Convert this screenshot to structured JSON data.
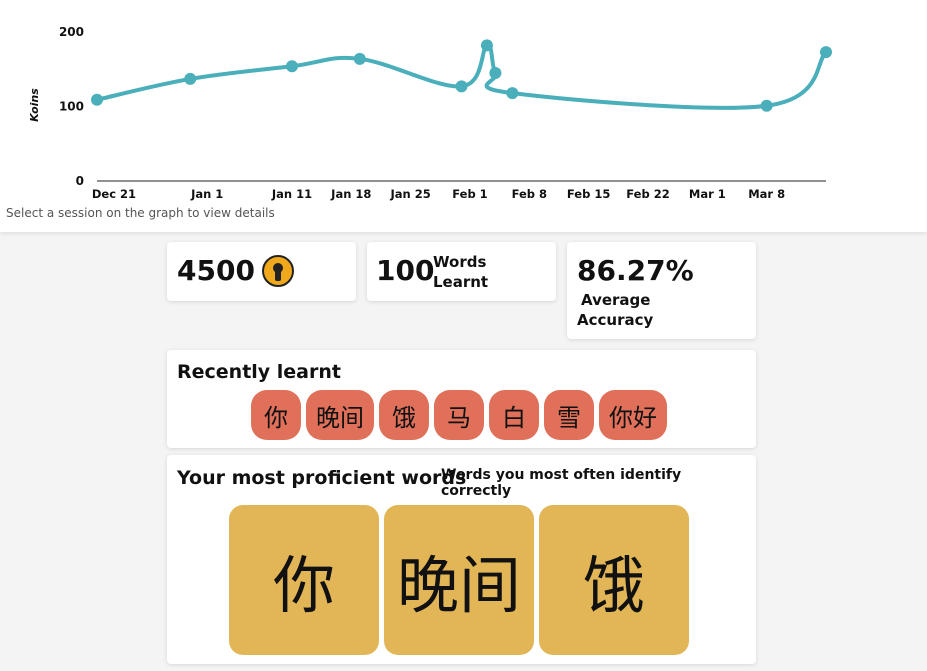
{
  "chart_data": {
    "type": "line",
    "ylabel": "Koins",
    "yticks": [
      "0",
      "100",
      "200"
    ],
    "ylim": [
      0,
      200
    ],
    "xticks": [
      "Dec 21",
      "Jan 1",
      "Jan 11",
      "Jan 18",
      "Jan 25",
      "Feb 1",
      "Feb 8",
      "Feb 15",
      "Feb 22",
      "Mar 1",
      "Mar 8"
    ],
    "x": [
      "Dec 19",
      "Dec 30",
      "Jan 11",
      "Jan 19",
      "Jan 31",
      "Feb 3",
      "Feb 4",
      "Feb 6",
      "Mar 8",
      "Mar 15"
    ],
    "y": [
      109,
      137,
      154,
      164,
      127,
      182,
      145,
      118,
      101,
      173
    ],
    "line_color": "#4aafbb",
    "grid": false
  },
  "hint_text": "Select a session on the graph to view details",
  "stats": {
    "koins_value": "4500",
    "koins_icon": "keyhole-coin-icon",
    "words_value": "100",
    "words_label_1": "Words",
    "words_label_2": "Learnt",
    "accuracy_value": "86.27%",
    "accuracy_label_1": "Average",
    "accuracy_label_2": "Accuracy"
  },
  "recent": {
    "title": "Recently learnt",
    "words": [
      "你",
      "晚间",
      "饿",
      "马",
      "白",
      "雪",
      "你好"
    ],
    "chip_color": "#e07059"
  },
  "proficient": {
    "title": "Your most proficient words",
    "subtitle": "Words you most often identify correctly",
    "words": [
      "你",
      "晚间",
      "饿"
    ],
    "tile_color": "#e2b656"
  }
}
